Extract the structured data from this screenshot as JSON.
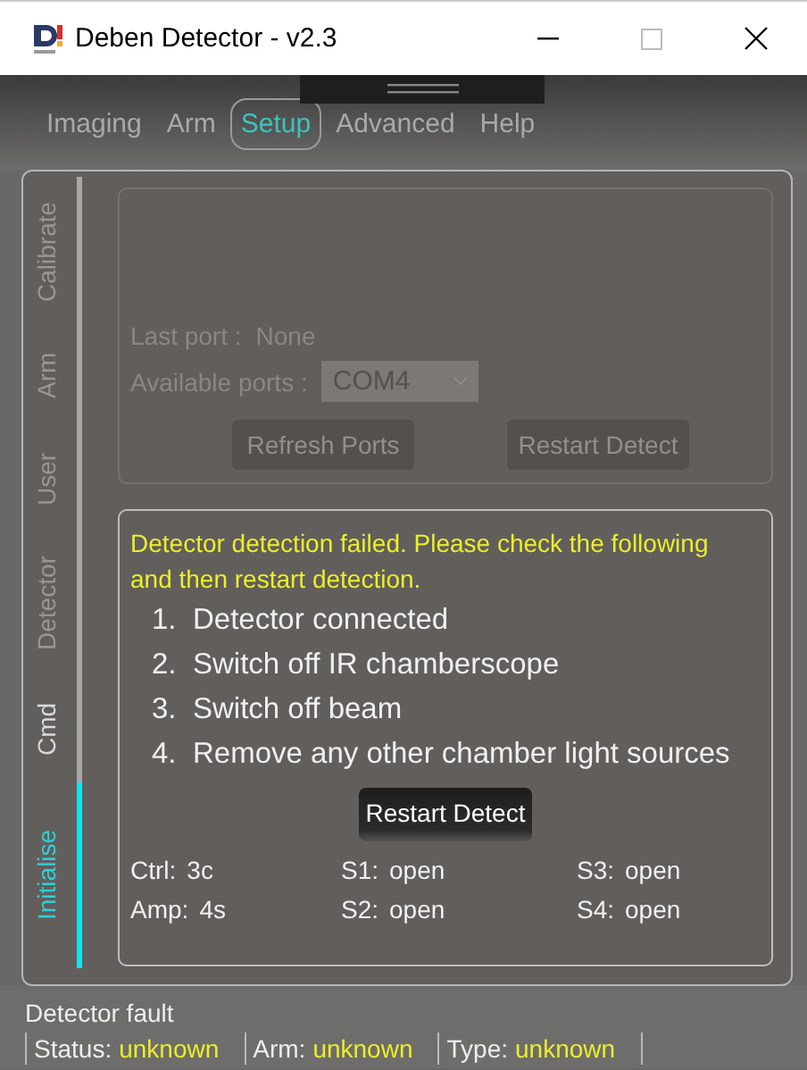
{
  "window": {
    "title": "Deben Detector - v2.3"
  },
  "menu": [
    {
      "label": "Imaging",
      "selected": false
    },
    {
      "label": "Arm",
      "selected": false
    },
    {
      "label": "Setup",
      "selected": true
    },
    {
      "label": "Advanced",
      "selected": false
    },
    {
      "label": "Help",
      "selected": false
    }
  ],
  "side_tabs": [
    {
      "label": "Calibrate",
      "selected": false
    },
    {
      "label": "Arm",
      "selected": false
    },
    {
      "label": "User",
      "selected": false
    },
    {
      "label": "Detector",
      "selected": false
    },
    {
      "label": "Cmd",
      "selected": false
    },
    {
      "label": "Initialise",
      "selected": true
    }
  ],
  "port_panel": {
    "disabled": true,
    "last_port_label": "Last port :",
    "last_port": "None",
    "ports_label": "Available ports :",
    "port_value": "COM4",
    "buttons": [
      "Refresh Ports",
      "Restart Detect"
    ]
  },
  "detect_panel": {
    "message": "Detector detection failed. Please check the following and then restart detection.",
    "steps": [
      {
        "number": "1.",
        "text": "Detector connected"
      },
      {
        "number": "2.",
        "text": "Switch off IR chamberscope"
      },
      {
        "number": "3.",
        "text": "Switch off beam"
      },
      {
        "number": "4.",
        "text": "Remove any other chamber light sources"
      }
    ],
    "button": "Restart Detect",
    "readings": [
      {
        "label": "Ctrl:",
        "value": "3c"
      },
      {
        "label": "S1:",
        "value": "open"
      },
      {
        "label": "S3:",
        "value": "open"
      },
      {
        "label": "Amp:",
        "value": "4s"
      },
      {
        "label": "S2:",
        "value": "open"
      },
      {
        "label": "S4:",
        "value": "open"
      }
    ]
  },
  "status": {
    "message": "Detector fault",
    "fields": [
      {
        "label": "Status:",
        "value": "unknown"
      },
      {
        "label": "Arm:",
        "value": "unknown"
      },
      {
        "label": "Type:",
        "value": "unknown"
      }
    ]
  }
}
